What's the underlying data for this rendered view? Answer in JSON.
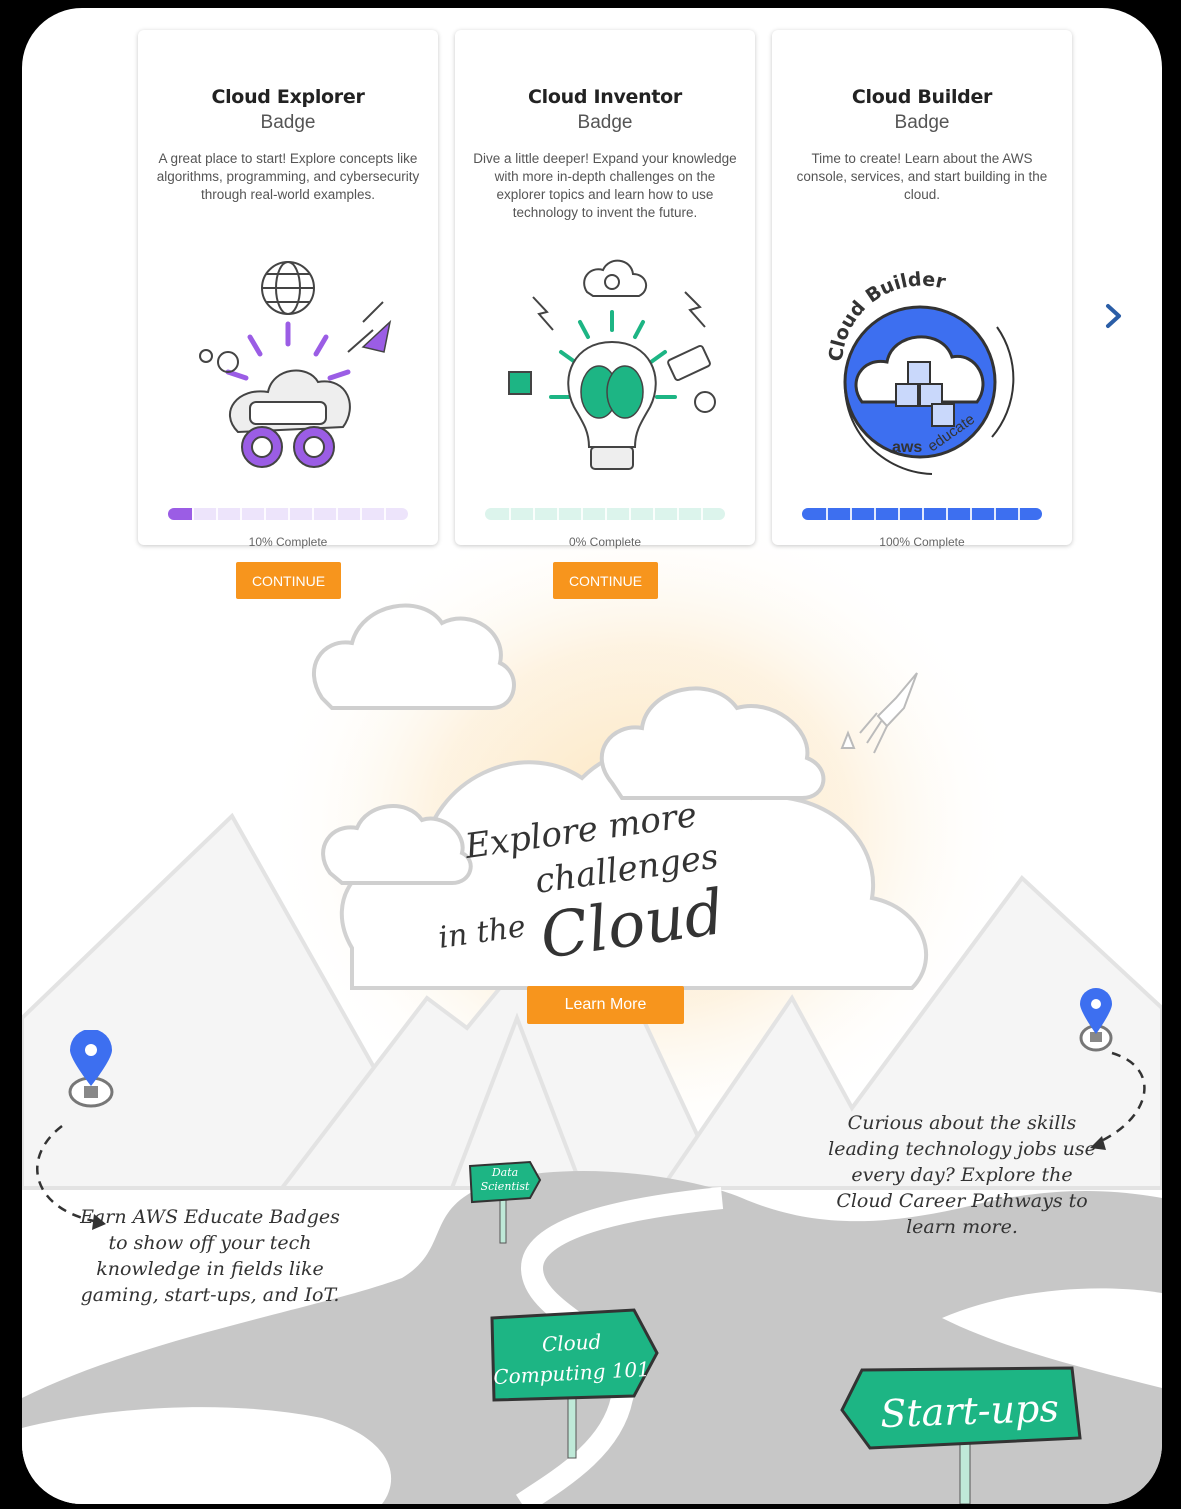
{
  "cards": [
    {
      "title": "Cloud Explorer",
      "subtitle": "Badge",
      "description": "A great place to start! Explore concepts like algorithms, programming, and cybersecurity through real-world examples.",
      "progress": 0.1,
      "status": "10% Complete",
      "color": "#9b5de5",
      "track": "#ede4fb",
      "button": "CONTINUE"
    },
    {
      "title": "Cloud Inventor",
      "subtitle": "Badge",
      "description": "Dive a little deeper! Expand your knowledge with more in-depth challenges on the explorer topics and learn how to use technology to invent the future.",
      "progress": 0,
      "status": "0% Complete",
      "color": "#1db584",
      "track": "#dcf4ec",
      "button": "CONTINUE"
    },
    {
      "title": "Cloud Builder",
      "subtitle": "Badge",
      "description": "Time to create! Learn about the AWS console, services, and start building in the cloud.",
      "progress": 1,
      "status": "100% Complete",
      "color": "#3d6ff0",
      "track": "#dfe7fd",
      "badge_text": "Cloud Builder",
      "badge_logo": "aws",
      "badge_logo_suffix": "educate"
    }
  ],
  "promo": {
    "line1": "Explore more",
    "line2": "challenges",
    "line3a": "in the",
    "line3b": "Cloud",
    "button": "Learn More"
  },
  "notes": {
    "left": "Earn AWS Educate Badges to show off your tech knowledge in fields like gaming, start-ups, and IoT.",
    "right": "Curious about the skills leading technology jobs use every day? Explore the Cloud Career Pathways to learn more."
  },
  "signs": {
    "data_line1": "Data",
    "data_line2": "Scientist",
    "cloud_line1": "Cloud",
    "cloud_line2": "Computing 101",
    "startups": "Start-ups"
  },
  "icons": {
    "next": "chevron-right-icon",
    "pin": "map-pin-icon"
  },
  "colors": {
    "accent": "#f7951d",
    "pin": "#3d6ff0",
    "sign": "#1db584",
    "chevron": "#2b5ea7"
  }
}
